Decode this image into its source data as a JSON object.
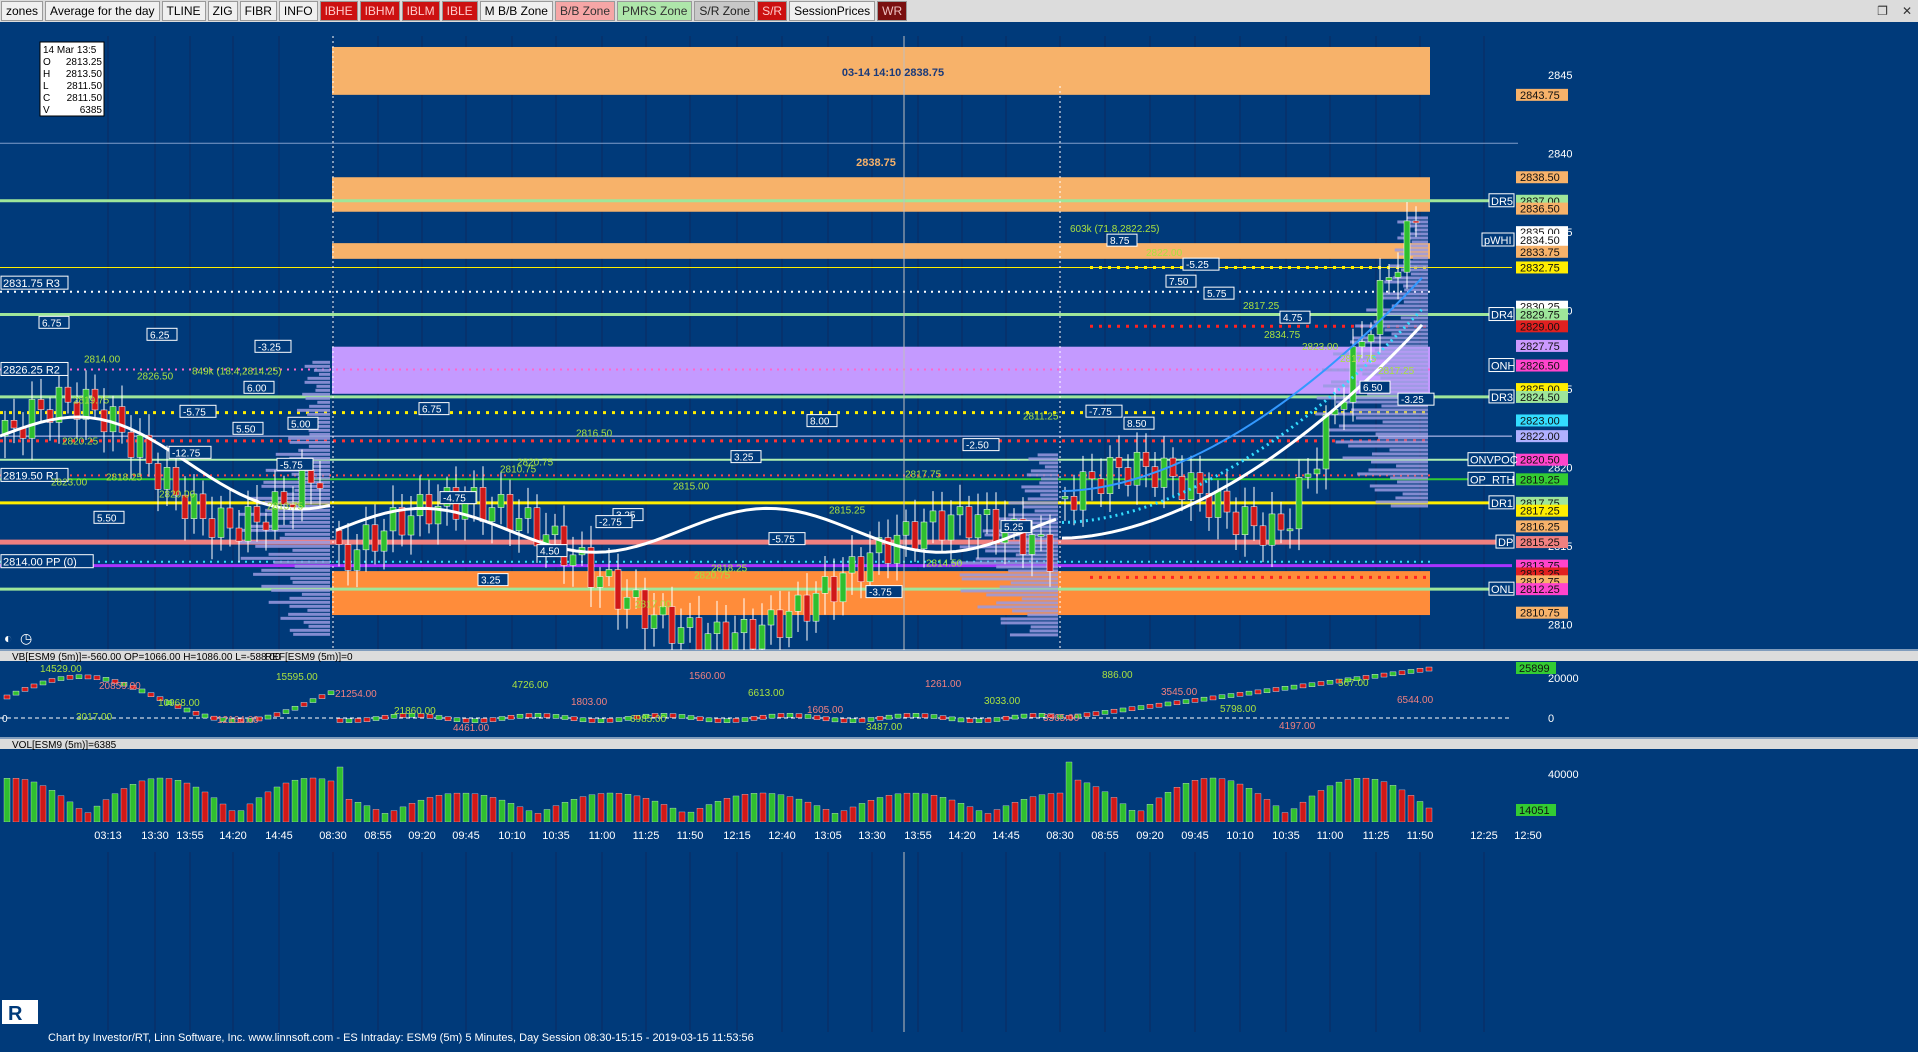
{
  "toolbar": [
    {
      "label": "zones",
      "style": "plain"
    },
    {
      "label": "Average for the day",
      "style": "plain"
    },
    {
      "label": "TLINE",
      "style": "plain"
    },
    {
      "label": "ZIG",
      "style": "plain"
    },
    {
      "label": "FIBR",
      "style": "plain"
    },
    {
      "label": "INFO",
      "style": "plain"
    },
    {
      "label": "IBHE",
      "style": "red"
    },
    {
      "label": "IBHM",
      "style": "red"
    },
    {
      "label": "IBLM",
      "style": "red"
    },
    {
      "label": "IBLE",
      "style": "red"
    },
    {
      "label": "M B/B Zone",
      "style": "plain"
    },
    {
      "label": "B/B Zone",
      "style": "pink"
    },
    {
      "label": "PMRS Zone",
      "style": "green"
    },
    {
      "label": "S/R Zone",
      "style": "gray"
    },
    {
      "label": "S/R",
      "style": "red"
    },
    {
      "label": "SessionPrices",
      "style": "plain"
    },
    {
      "label": "WR",
      "style": "dark"
    }
  ],
  "ohlc_box": {
    "date": "14 Mar 13:5",
    "o": "2813.25",
    "h": "2813.50",
    "l": "2811.50",
    "c": "2811.50",
    "v": "6385"
  },
  "zone_labels": {
    "top_zone": "03-14 14:10  2838.75",
    "mid_zone": "2838.75"
  },
  "level_labels_left": [
    {
      "text": "2831.75 R3",
      "price": 2831.75
    },
    {
      "text": "2826.25 R2",
      "price": 2826.25
    },
    {
      "text": "2819.50 R1",
      "price": 2819.5
    },
    {
      "text": "2814.00 PP (0)",
      "price": 2814.0
    }
  ],
  "right_price_tags": [
    {
      "text": "2843.75",
      "price": 2843.75,
      "color": "#f7b26a"
    },
    {
      "text": "2838.50",
      "price": 2838.5,
      "color": "#f7b26a"
    },
    {
      "text": "2837.00",
      "price": 2837.0,
      "color": "#9ee69a"
    },
    {
      "text": "2836.50",
      "price": 2836.5,
      "color": "#f7b26a"
    },
    {
      "text": "2835.00",
      "price": 2835.0,
      "color": "#ffffff"
    },
    {
      "text": "2834.50",
      "price": 2834.5,
      "color": "#ffffff"
    },
    {
      "text": "2833.75",
      "price": 2833.75,
      "color": "#f7b26a"
    },
    {
      "text": "2832.75",
      "price": 2832.75,
      "color": "#ffee00"
    },
    {
      "text": "2830.25",
      "price": 2830.25,
      "color": "#ffffff"
    },
    {
      "text": "2829.75",
      "price": 2829.75,
      "color": "#9ee69a"
    },
    {
      "text": "2829.00",
      "price": 2829.0,
      "color": "#e02020"
    },
    {
      "text": "2827.75",
      "price": 2827.75,
      "color": "#cc99ff"
    },
    {
      "text": "2826.50",
      "price": 2826.5,
      "color": "#ff44cc"
    },
    {
      "text": "2825.00",
      "price": 2825.0,
      "color": "#ffee00"
    },
    {
      "text": "2824.50",
      "price": 2824.5,
      "color": "#9ee69a"
    },
    {
      "text": "2823.00",
      "price": 2823.0,
      "color": "#33ddff"
    },
    {
      "text": "2822.00",
      "price": 2822.0,
      "color": "#b0b0ff"
    },
    {
      "text": "2820.50",
      "price": 2820.5,
      "color": "#ff44cc"
    },
    {
      "text": "2819.25",
      "price": 2819.25,
      "color": "#33cc33"
    },
    {
      "text": "2817.75",
      "price": 2817.75,
      "color": "#9ee69a"
    },
    {
      "text": "2817.25",
      "price": 2817.25,
      "color": "#ffee00"
    },
    {
      "text": "2816.25",
      "price": 2816.25,
      "color": "#f7b26a"
    },
    {
      "text": "2815.25",
      "price": 2815.25,
      "color": "#f08080"
    },
    {
      "text": "2813.75",
      "price": 2813.75,
      "color": "#ff44cc"
    },
    {
      "text": "2813.25",
      "price": 2813.25,
      "color": "#e02020"
    },
    {
      "text": "2812.75",
      "price": 2812.75,
      "color": "#f7b26a"
    },
    {
      "text": "2812.25",
      "price": 2812.25,
      "color": "#ff44cc"
    },
    {
      "text": "2810.75",
      "price": 2810.75,
      "color": "#f7b26a"
    }
  ],
  "right_side_labels": [
    {
      "text": "DR5",
      "price": 2837.0
    },
    {
      "text": "pWHI",
      "price": 2834.5
    },
    {
      "text": "DR4",
      "price": 2829.75
    },
    {
      "text": "ONH",
      "price": 2826.5
    },
    {
      "text": "DR3",
      "price": 2824.5
    },
    {
      "text": "ONVPOC",
      "price": 2820.5
    },
    {
      "text": "OP_RTH",
      "price": 2819.25
    },
    {
      "text": "DR1",
      "price": 2817.75
    },
    {
      "text": "DP",
      "price": 2815.25
    },
    {
      "text": "ONL",
      "price": 2812.25
    }
  ],
  "price_axis": [
    2845,
    2840,
    2835,
    2830,
    2825,
    2820,
    2815,
    2810
  ],
  "annotations_left": [
    "6.75",
    "2826.50",
    "5.50",
    "2823.00",
    "6.25",
    "6.00",
    "2820.25",
    "2820.00",
    "-3.25",
    "2819.75",
    "-12.75",
    "2813.75",
    "2814.00",
    "-5.75",
    "-5.75",
    "5.50",
    "849k (18.4,2814.25)",
    "5.00",
    "2818.25"
  ],
  "annotations_mid": [
    "6.75",
    "2820.75",
    "3.25",
    "2818.25",
    "8.00",
    "2817.75",
    "5.25",
    "3.25",
    "2816.50",
    "2815.00",
    "-5.75",
    "-3.75",
    "-2.50",
    "-4.75",
    "4.50",
    "2817.00",
    "3.25",
    "2815.25",
    "2814.50",
    "2811.25",
    "2810.75",
    "-2.75",
    "2820.75"
  ],
  "annotations_right": [
    "603k (71.8,2822.25)",
    "7.50",
    "2834.75",
    "6.50",
    "8.75",
    "5.75",
    "2823.00",
    "-3.25",
    "2822.00",
    "2817.25",
    "2817.75",
    "-7.75",
    "-5.25",
    "4.75",
    "2817.25",
    "8.50"
  ],
  "panel_vb": {
    "header": "VB[ESM9 (5m)]=-560.00 OP=1066.00 H=1086.00 L=-588.00",
    "header2": "REF[ESM9 (5m)]=0",
    "labels": [
      "14529.00",
      "20859.00",
      "10968.00",
      "12164.00",
      "15595.00",
      "21254.00",
      "21860.00",
      "4461.00",
      "4726.00",
      "1803.00",
      "6985.00",
      "1560.00",
      "6613.00",
      "1605.00",
      "3487.00",
      "1261.00",
      "3033.00",
      "3365.00",
      "886.00",
      "3545.00",
      "5798.00",
      "4197.00",
      "567.00",
      "6544.00",
      "3017.00"
    ],
    "axis": [
      "20000",
      "0"
    ],
    "tag": "25899",
    "zero": "0"
  },
  "panel_vol": {
    "header": "VOL[ESM9 (5m)]=6385",
    "axis": [
      "40000"
    ],
    "tag": "14051"
  },
  "time_axis": [
    "03:13",
    "13:30",
    "13:55",
    "14:20",
    "14:45",
    "08:30",
    "08:55",
    "09:20",
    "09:45",
    "10:10",
    "10:35",
    "11:00",
    "11:25",
    "11:50",
    "12:15",
    "12:40",
    "13:05",
    "13:30",
    "13:55",
    "14:20",
    "14:45",
    "08:30",
    "08:55",
    "09:20",
    "09:45",
    "10:10",
    "10:35",
    "11:00",
    "11:25",
    "11:50",
    "12:25",
    "12:50"
  ],
  "footer": "Chart by Investor/RT, Linn Software, Inc. www.linnsoft.com - ES Intraday: ESM9 (5m) 5 Minutes, Day Session 08:30-15:15 - 2019-03-15 11:53:56",
  "colors": {
    "background": "#003a7a",
    "bull": "#2fbf2f",
    "bear": "#d01818",
    "zone_orange": "#f7b26a",
    "zone_purple": "#c49aff",
    "vwap": "#ffffff"
  }
}
